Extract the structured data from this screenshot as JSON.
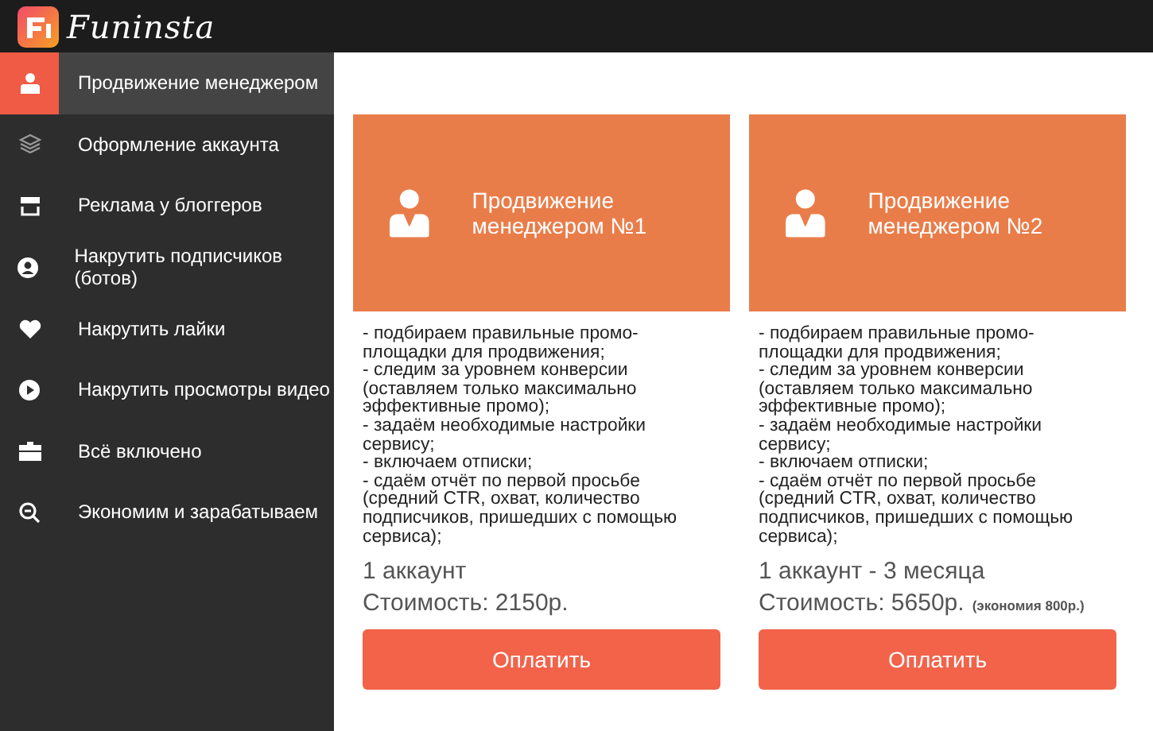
{
  "header": {
    "brand": "Funinsta"
  },
  "sidebar": {
    "items": [
      {
        "label": "Продвижение менеджером",
        "selected": true
      },
      {
        "label": "Оформление аккаунта",
        "selected": false
      },
      {
        "label": "Реклама у блоггеров",
        "selected": false
      },
      {
        "label": "Накрутить подписчиков (ботов)",
        "selected": false
      },
      {
        "label": "Накрутить лайки",
        "selected": false
      },
      {
        "label": "Накрутить просмотры видео",
        "selected": false
      },
      {
        "label": "Всё включено",
        "selected": false
      },
      {
        "label": "Экономим и зарабатываем",
        "selected": false
      }
    ]
  },
  "plans": [
    {
      "title": "Продвижение менеджером №1",
      "features": [
        "- подбираем правильные промо-площадки для продвижения;",
        "- следим за уровнем конверсии (оставляем только максимально эффективные промо);",
        "- задаём необходимые настройки сервису;",
        "- включаем отписки;",
        "- сдаём отчёт по первой просьбе (средний CTR, охват, количество подписчиков, пришедших с помощью сервиса);"
      ],
      "term": "1 аккаунт",
      "price": "Стоимость: 2150р.",
      "button": "Оплатить"
    },
    {
      "title": "Продвижение менеджером №2",
      "features": [
        "- подбираем правильные промо-площадки для продвижения;",
        "- следим за уровнем конверсии (оставляем только максимально эффективные промо);",
        "- задаём необходимые настройки сервису;",
        "- включаем отписки;",
        "- сдаём отчёт по первой просьбе (средний CTR, охват, количество подписчиков, пришедших с помощью сервиса);"
      ],
      "term": "1 аккаунт - 3 месяца",
      "price": "Стоимость: 5650р.",
      "savings": "(экономия 800р.)",
      "button": "Оплатить"
    }
  ]
}
